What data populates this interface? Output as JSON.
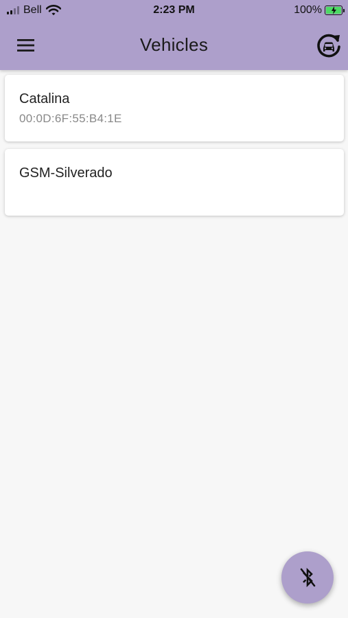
{
  "status_bar": {
    "carrier": "Bell",
    "time": "2:23 PM",
    "battery": "100%",
    "signal_icon": "signal-bars-icon",
    "wifi_icon": "wifi-icon",
    "battery_icon": "battery-charging-icon"
  },
  "app_bar": {
    "title": "Vehicles",
    "menu_icon": "hamburger-menu-icon",
    "action_icon": "refresh-vehicle-icon",
    "color": "#ad9fcb"
  },
  "vehicles": [
    {
      "name": "Catalina",
      "address": "00:0D:6F:55:B4:1E"
    },
    {
      "name": "GSM-Silverado",
      "address": ""
    }
  ],
  "fab": {
    "icon": "bluetooth-disabled-icon",
    "color": "#ad9fcb"
  }
}
